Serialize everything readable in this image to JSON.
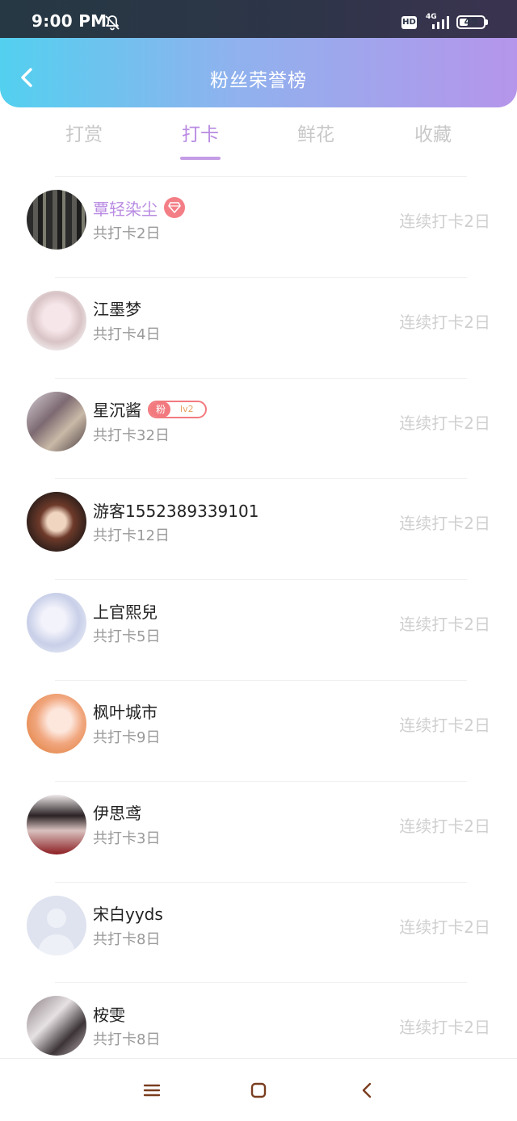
{
  "status_bar": {
    "time": "9:00 PM",
    "hd": "HD",
    "network": "4G",
    "battery": "45",
    "battery_level": 0.45
  },
  "header": {
    "title": "粉丝荣誉榜"
  },
  "tabs": [
    {
      "label": "打赏",
      "active": false
    },
    {
      "label": "打卡",
      "active": true
    },
    {
      "label": "鲜花",
      "active": false
    },
    {
      "label": "收藏",
      "active": false
    }
  ],
  "list": [
    {
      "name": "覃轻染尘",
      "total": "共打卡2日",
      "streak": "连续打卡2日",
      "badge": "diamond",
      "highlight": true
    },
    {
      "name": "江墨梦",
      "total": "共打卡4日",
      "streak": "连续打卡2日"
    },
    {
      "name": "星沉酱",
      "total": "共打卡32日",
      "streak": "连续打卡2日",
      "badge": "fan",
      "badge_label": "粉",
      "badge_level": "lv2"
    },
    {
      "name": "游客1552389339101",
      "total": "共打卡12日",
      "streak": "连续打卡2日"
    },
    {
      "name": "上官熙兒",
      "total": "共打卡5日",
      "streak": "连续打卡2日"
    },
    {
      "name": "枫叶城市",
      "total": "共打卡9日",
      "streak": "连续打卡2日"
    },
    {
      "name": "伊思鸢",
      "total": "共打卡3日",
      "streak": "连续打卡2日"
    },
    {
      "name": "宋白yyds",
      "total": "共打卡8日",
      "streak": "连续打卡2日"
    },
    {
      "name": "桉雯",
      "total": "共打卡8日",
      "streak": "连续打卡2日"
    }
  ],
  "colors": {
    "accent": "#b88ae2",
    "header_start": "#53d0ef",
    "header_end": "#b595ea",
    "badge_red": "#f27a7f"
  },
  "nav_bar": {
    "icons": [
      "menu-icon",
      "home-square-icon",
      "back-chevron-icon"
    ]
  }
}
